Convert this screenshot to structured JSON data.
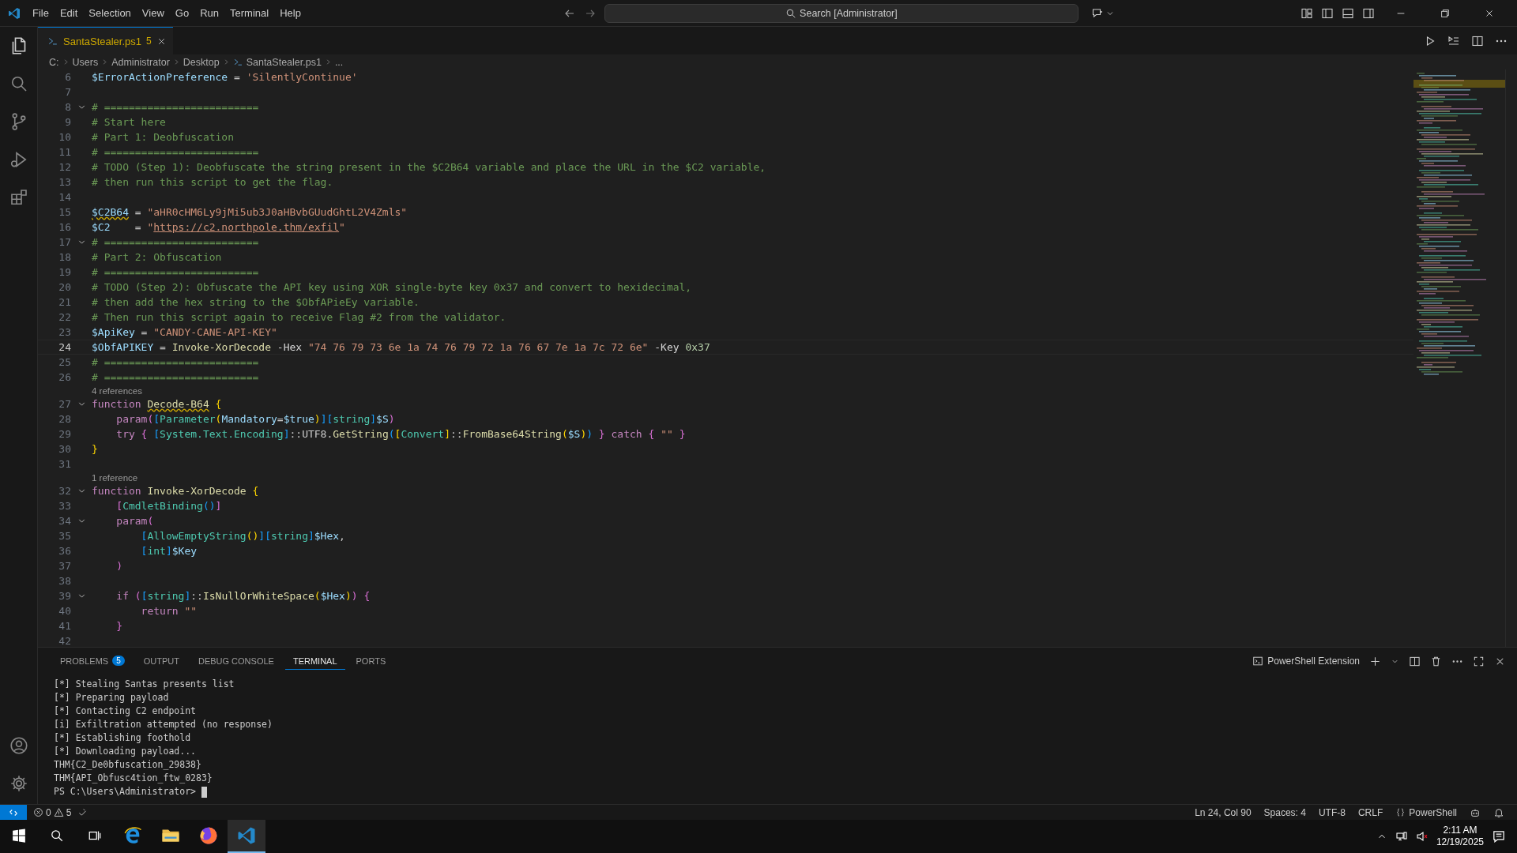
{
  "menu": [
    "File",
    "Edit",
    "Selection",
    "View",
    "Go",
    "Run",
    "Terminal",
    "Help"
  ],
  "search": {
    "placeholder": "Search [Administrator]"
  },
  "tabs": [
    {
      "label": "SantaStealer.ps1",
      "badge": "5",
      "selected": true
    }
  ],
  "breadcrumb": [
    {
      "text": "C:",
      "kind": "folder"
    },
    {
      "text": "Users",
      "kind": "folder"
    },
    {
      "text": "Administrator",
      "kind": "folder"
    },
    {
      "text": "Desktop",
      "kind": "folder"
    },
    {
      "text": "SantaStealer.ps1",
      "kind": "file"
    },
    {
      "text": "...",
      "kind": "more"
    }
  ],
  "editor": {
    "lines": [
      {
        "kind": "code",
        "number": "6",
        "current": false,
        "foldable": false,
        "tokens": [
          {
            "kind": "variable",
            "text": "$ErrorActionPreference"
          },
          {
            "kind": "plain",
            "text": " = "
          },
          {
            "kind": "string",
            "text": "'SilentlyContinue'"
          }
        ]
      },
      {
        "kind": "code",
        "number": "7",
        "current": false,
        "foldable": false
      },
      {
        "kind": "code",
        "number": "8",
        "current": false,
        "foldable": true,
        "tokens": [
          {
            "kind": "comment",
            "text": "# ========================="
          }
        ]
      },
      {
        "kind": "code",
        "number": "9",
        "current": false,
        "foldable": false,
        "tokens": [
          {
            "kind": "comment",
            "text": "# Start here"
          }
        ]
      },
      {
        "kind": "code",
        "number": "10",
        "current": false,
        "foldable": false,
        "tokens": [
          {
            "kind": "comment",
            "text": "# Part 1: Deobfuscation"
          }
        ]
      },
      {
        "kind": "code",
        "number": "11",
        "current": false,
        "foldable": false,
        "tokens": [
          {
            "kind": "comment",
            "text": "# ========================="
          }
        ]
      },
      {
        "kind": "code",
        "number": "12",
        "current": false,
        "foldable": false,
        "tokens": [
          {
            "kind": "comment",
            "text": "# TODO (Step 1): Deobfuscate the string present in the $C2B64 variable and place the URL in the $C2 variable,"
          }
        ]
      },
      {
        "kind": "code",
        "number": "13",
        "current": false,
        "foldable": false,
        "tokens": [
          {
            "kind": "comment",
            "text": "# then run this script to get the flag."
          }
        ]
      },
      {
        "kind": "code",
        "number": "14",
        "current": false,
        "foldable": false
      },
      {
        "kind": "code",
        "number": "15",
        "current": false,
        "foldable": false,
        "tokens": [
          {
            "kind": "variable",
            "text": "$C2B64",
            "warning": true
          },
          {
            "kind": "plain",
            "text": " = "
          },
          {
            "kind": "string",
            "text": "\"aHR0cHM6Ly9jMi5ub3J0aHBvbGUudGhtL2V4Zmls\""
          }
        ]
      },
      {
        "kind": "code",
        "number": "16",
        "current": false,
        "foldable": false,
        "tokens": [
          {
            "kind": "variable",
            "text": "$C2"
          },
          {
            "kind": "plain",
            "text": "    = "
          },
          {
            "kind": "string",
            "text": "\""
          },
          {
            "kind": "link",
            "text": "https://c2.northpole.thm/exfil"
          },
          {
            "kind": "string",
            "text": "\""
          }
        ]
      },
      {
        "kind": "code",
        "number": "17",
        "current": false,
        "foldable": true,
        "tokens": [
          {
            "kind": "comment",
            "text": "# ========================="
          }
        ]
      },
      {
        "kind": "code",
        "number": "18",
        "current": false,
        "foldable": false,
        "tokens": [
          {
            "kind": "comment",
            "text": "# Part 2: Obfuscation"
          }
        ]
      },
      {
        "kind": "code",
        "number": "19",
        "current": false,
        "foldable": false,
        "tokens": [
          {
            "kind": "comment",
            "text": "# ========================="
          }
        ]
      },
      {
        "kind": "code",
        "number": "20",
        "current": false,
        "foldable": false,
        "tokens": [
          {
            "kind": "comment",
            "text": "# TODO (Step 2): Obfuscate the API key using XOR single-byte key 0x37 and convert to hexidecimal,"
          }
        ]
      },
      {
        "kind": "code",
        "number": "21",
        "current": false,
        "foldable": false,
        "tokens": [
          {
            "kind": "comment",
            "text": "# then add the hex string to the $ObfAPieEy variable."
          }
        ]
      },
      {
        "kind": "code",
        "number": "22",
        "current": false,
        "foldable": false,
        "tokens": [
          {
            "kind": "comment",
            "text": "# Then run this script again to receive Flag #2 from the validator."
          }
        ]
      },
      {
        "kind": "code",
        "number": "23",
        "current": false,
        "foldable": false,
        "tokens": [
          {
            "kind": "variable",
            "text": "$ApiKey"
          },
          {
            "kind": "plain",
            "text": " = "
          },
          {
            "kind": "string",
            "text": "\"CANDY-CANE-API-KEY\""
          }
        ]
      },
      {
        "kind": "code",
        "number": "24",
        "current": true,
        "foldable": false,
        "tokens": [
          {
            "kind": "variable",
            "text": "$ObfAPIKEY"
          },
          {
            "kind": "plain",
            "text": " = "
          },
          {
            "kind": "function",
            "text": "Invoke-XorDecode"
          },
          {
            "kind": "parameter",
            "text": " -Hex "
          },
          {
            "kind": "string",
            "text": "\"74 76 79 73 6e 1a 74 76 79 72 1a 76 67 7e 1a 7c 72 6e\""
          },
          {
            "kind": "parameter",
            "text": " -Key "
          },
          {
            "kind": "number",
            "text": "0x37"
          }
        ]
      },
      {
        "kind": "code",
        "number": "25",
        "current": false,
        "foldable": false,
        "tokens": [
          {
            "kind": "comment",
            "text": "# ========================="
          }
        ]
      },
      {
        "kind": "code",
        "number": "26",
        "current": false,
        "foldable": false,
        "tokens": [
          {
            "kind": "comment",
            "text": "# ========================="
          }
        ]
      },
      {
        "kind": "codelens",
        "text": "4 references"
      },
      {
        "kind": "code",
        "number": "27",
        "current": false,
        "foldable": true,
        "tokens": [
          {
            "kind": "keyword",
            "text": "function "
          },
          {
            "kind": "function",
            "text": "Decode-B64",
            "warning": true
          },
          {
            "kind": "bracket1",
            "text": " {"
          }
        ]
      },
      {
        "kind": "code",
        "number": "28",
        "current": false,
        "foldable": false,
        "tokens": [
          {
            "kind": "keyword",
            "text": "    param"
          },
          {
            "kind": "bracket2",
            "text": "("
          },
          {
            "kind": "bracket3",
            "text": "["
          },
          {
            "kind": "type",
            "text": "Parameter"
          },
          {
            "kind": "bracket1",
            "text": "("
          },
          {
            "kind": "variable",
            "text": "Mandatory"
          },
          {
            "kind": "plain",
            "text": "="
          },
          {
            "kind": "variable",
            "text": "$true"
          },
          {
            "kind": "bracket1",
            "text": ")"
          },
          {
            "kind": "bracket3",
            "text": "]["
          },
          {
            "kind": "type",
            "text": "string"
          },
          {
            "kind": "bracket3",
            "text": "]"
          },
          {
            "kind": "variable",
            "text": "$S"
          },
          {
            "kind": "bracket2",
            "text": ")"
          }
        ]
      },
      {
        "kind": "code",
        "number": "29",
        "current": false,
        "foldable": false,
        "tokens": [
          {
            "kind": "keyword",
            "text": "    try"
          },
          {
            "kind": "bracket2",
            "text": " {"
          },
          {
            "kind": "bracket3",
            "text": " ["
          },
          {
            "kind": "type",
            "text": "System.Text.Encoding"
          },
          {
            "kind": "bracket3",
            "text": "]"
          },
          {
            "kind": "plain",
            "text": "::UTF8."
          },
          {
            "kind": "function",
            "text": "GetString"
          },
          {
            "kind": "bracket3",
            "text": "("
          },
          {
            "kind": "bracket1",
            "text": "["
          },
          {
            "kind": "type",
            "text": "Convert"
          },
          {
            "kind": "bracket1",
            "text": "]"
          },
          {
            "kind": "plain",
            "text": "::"
          },
          {
            "kind": "function",
            "text": "FromBase64String"
          },
          {
            "kind": "bracket1",
            "text": "("
          },
          {
            "kind": "variable",
            "text": "$S"
          },
          {
            "kind": "bracket1",
            "text": ")"
          },
          {
            "kind": "bracket3",
            "text": ")"
          },
          {
            "kind": "bracket2",
            "text": " }"
          },
          {
            "kind": "keyword",
            "text": " catch"
          },
          {
            "kind": "bracket2",
            "text": " {"
          },
          {
            "kind": "string",
            "text": " \"\""
          },
          {
            "kind": "bracket2",
            "text": " }"
          }
        ]
      },
      {
        "kind": "code",
        "number": "30",
        "current": false,
        "foldable": false,
        "tokens": [
          {
            "kind": "bracket1",
            "text": "}"
          }
        ]
      },
      {
        "kind": "code",
        "number": "31",
        "current": false,
        "foldable": false
      },
      {
        "kind": "codelens",
        "text": "1 reference"
      },
      {
        "kind": "code",
        "number": "32",
        "current": false,
        "foldable": true,
        "tokens": [
          {
            "kind": "keyword",
            "text": "function "
          },
          {
            "kind": "function",
            "text": "Invoke-XorDecode"
          },
          {
            "kind": "bracket1",
            "text": " {"
          }
        ]
      },
      {
        "kind": "code",
        "number": "33",
        "current": false,
        "foldable": false,
        "tokens": [
          {
            "kind": "bracket2",
            "text": "    ["
          },
          {
            "kind": "type",
            "text": "CmdletBinding"
          },
          {
            "kind": "bracket3",
            "text": "()"
          },
          {
            "kind": "bracket2",
            "text": "]"
          }
        ]
      },
      {
        "kind": "code",
        "number": "34",
        "current": false,
        "foldable": true,
        "tokens": [
          {
            "kind": "keyword",
            "text": "    param"
          },
          {
            "kind": "bracket2",
            "text": "("
          }
        ]
      },
      {
        "kind": "code",
        "number": "35",
        "current": false,
        "foldable": false,
        "tokens": [
          {
            "kind": "bracket3",
            "text": "        ["
          },
          {
            "kind": "type",
            "text": "AllowEmptyString"
          },
          {
            "kind": "bracket1",
            "text": "()"
          },
          {
            "kind": "bracket3",
            "text": "]["
          },
          {
            "kind": "type",
            "text": "string"
          },
          {
            "kind": "bracket3",
            "text": "]"
          },
          {
            "kind": "variable",
            "text": "$Hex"
          },
          {
            "kind": "plain",
            "text": ","
          }
        ]
      },
      {
        "kind": "code",
        "number": "36",
        "current": false,
        "foldable": false,
        "tokens": [
          {
            "kind": "bracket3",
            "text": "        ["
          },
          {
            "kind": "type",
            "text": "int"
          },
          {
            "kind": "bracket3",
            "text": "]"
          },
          {
            "kind": "variable",
            "text": "$Key"
          }
        ]
      },
      {
        "kind": "code",
        "number": "37",
        "current": false,
        "foldable": false,
        "tokens": [
          {
            "kind": "bracket2",
            "text": "    )"
          }
        ]
      },
      {
        "kind": "code",
        "number": "38",
        "current": false,
        "foldable": false
      },
      {
        "kind": "code",
        "number": "39",
        "current": false,
        "foldable": true,
        "tokens": [
          {
            "kind": "keyword",
            "text": "    if"
          },
          {
            "kind": "bracket2",
            "text": " ("
          },
          {
            "kind": "bracket3",
            "text": "["
          },
          {
            "kind": "type",
            "text": "string"
          },
          {
            "kind": "bracket3",
            "text": "]"
          },
          {
            "kind": "plain",
            "text": "::"
          },
          {
            "kind": "function",
            "text": "IsNullOrWhiteSpace"
          },
          {
            "kind": "bracket1",
            "text": "("
          },
          {
            "kind": "variable",
            "text": "$Hex"
          },
          {
            "kind": "bracket1",
            "text": ")"
          },
          {
            "kind": "bracket2",
            "text": ")"
          },
          {
            "kind": "bracket2",
            "text": " {"
          }
        ]
      },
      {
        "kind": "code",
        "number": "40",
        "current": false,
        "foldable": false,
        "tokens": [
          {
            "kind": "keyword",
            "text": "        return"
          },
          {
            "kind": "string",
            "text": " \"\""
          }
        ]
      },
      {
        "kind": "code",
        "number": "41",
        "current": false,
        "foldable": false,
        "tokens": [
          {
            "kind": "bracket2",
            "text": "    }"
          }
        ]
      },
      {
        "kind": "code",
        "number": "42",
        "current": false,
        "foldable": false
      }
    ]
  },
  "panel": {
    "tabs": [
      {
        "label": "PROBLEMS",
        "badge": "5",
        "selected": false
      },
      {
        "label": "OUTPUT",
        "selected": false
      },
      {
        "label": "DEBUG CONSOLE",
        "selected": false
      },
      {
        "label": "TERMINAL",
        "selected": true
      },
      {
        "label": "PORTS",
        "selected": false
      }
    ],
    "terminal_profile": "PowerShell Extension",
    "terminal_lines": [
      "[*] Stealing Santas presents list",
      "[*] Preparing payload",
      "[*] Contacting C2 endpoint",
      "[i] Exfiltration attempted (no response)",
      "[*] Establishing foothold",
      "[*] Downloading payload...",
      "THM{C2_De0bfuscation_29838}",
      "THM{API_Obfusc4tion_ftw_0283}"
    ],
    "prompt": "PS C:\\Users\\Administrator> "
  },
  "status_bar": {
    "errors": "0",
    "warnings": "5",
    "items": [
      "Ln 24, Col 90",
      "Spaces: 4",
      "UTF-8",
      "CRLF"
    ],
    "language": "PowerShell"
  },
  "taskbar": {
    "apps": [
      {
        "kind": "browser",
        "active": false
      },
      {
        "kind": "folder",
        "active": false
      },
      {
        "kind": "fox",
        "active": false
      },
      {
        "kind": "editor",
        "active": true
      }
    ],
    "time": "2:11 AM",
    "date": "12/19/2025"
  }
}
